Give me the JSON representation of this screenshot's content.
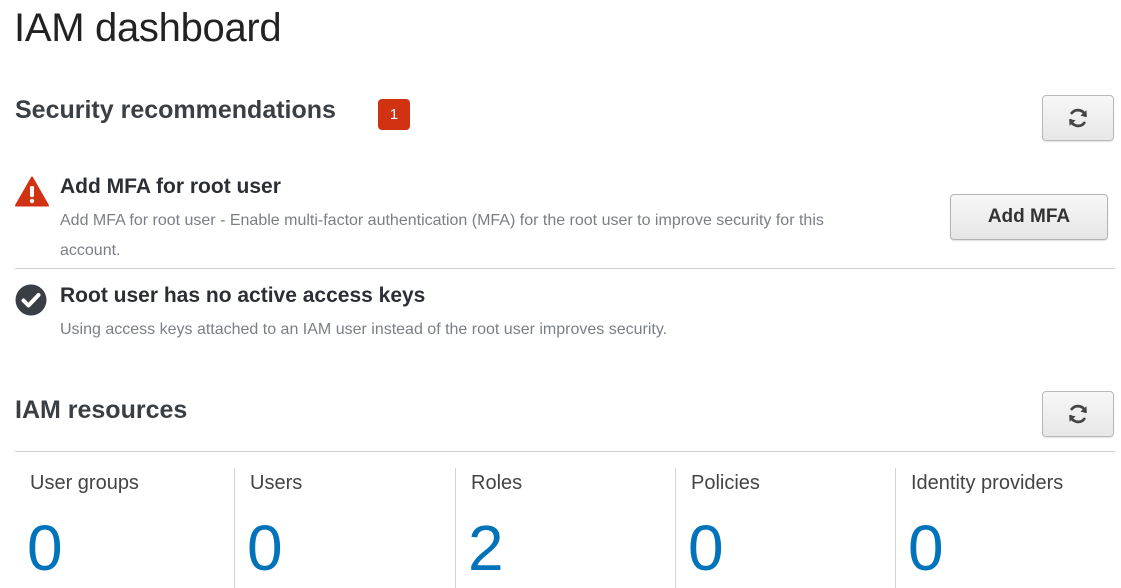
{
  "page": {
    "title": "IAM dashboard"
  },
  "security": {
    "title": "Security recommendations",
    "badge_count": "1",
    "refresh_icon": "refresh-icon",
    "recommendations": [
      {
        "status": "warning",
        "icon": "warning-icon",
        "status_color": "#d13212",
        "title": "Add MFA for root user",
        "description": "Add MFA for root user - Enable multi-factor authentication (MFA) for the root user to improve security for this account.",
        "action_label": "Add MFA"
      },
      {
        "status": "ok",
        "icon": "check-circle-icon",
        "status_color": "#3a3f45",
        "title": "Root user has no active access keys",
        "description": "Using access keys attached to an IAM user instead of the root user improves security."
      }
    ]
  },
  "resources": {
    "title": "IAM resources",
    "refresh_icon": "refresh-icon",
    "accent_color": "#0073bb",
    "items": [
      {
        "label": "User groups",
        "count": "0"
      },
      {
        "label": "Users",
        "count": "0"
      },
      {
        "label": "Roles",
        "count": "2"
      },
      {
        "label": "Policies",
        "count": "0"
      },
      {
        "label": "Identity providers",
        "count": "0"
      }
    ]
  }
}
